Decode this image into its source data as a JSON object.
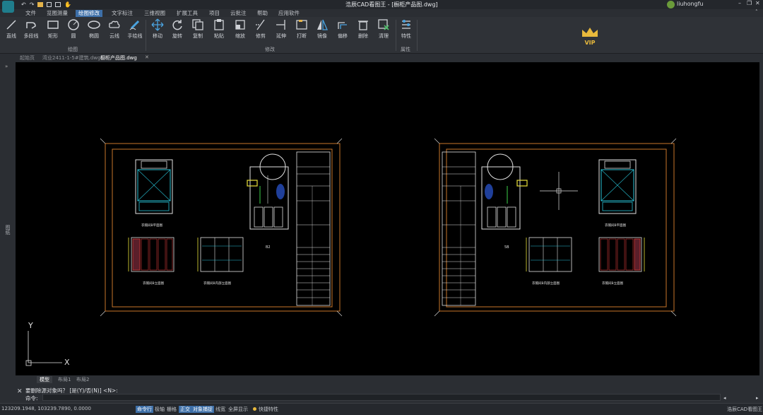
{
  "window": {
    "title": "浩辰CAD看图王 - [橱柜产品图.dwg]",
    "user": "liuhongfu"
  },
  "menu": [
    "文件",
    "览图测量",
    "绘图修改",
    "文字标注",
    "三维视图",
    "扩展工具",
    "项目",
    "云批注",
    "帮助",
    "应用软件"
  ],
  "menu_active": "绘图修改",
  "ribbon": {
    "draw_tools": [
      "直线",
      "多段线",
      "矩形",
      "圆",
      "椭圆",
      "云线",
      "手绘线"
    ],
    "draw_group": "绘图",
    "modify_tools": [
      "移动",
      "旋转",
      "复制",
      "粘贴",
      "缩放",
      "修剪",
      "延伸",
      "打断",
      "镜像",
      "偏移",
      "删除",
      "清理"
    ],
    "modify_group": "修改",
    "prop_tools": [
      "特性"
    ],
    "prop_group": "属性",
    "vip": "VIP"
  },
  "doc_tabs": [
    "起始页",
    "湾业2411-1-5#建筑.dwg",
    "橱柜产品图.dwg"
  ],
  "doc_tab_active": 2,
  "drawing": {
    "sheet_left": {
      "label_top": "衣帽间B平面图",
      "label_a": "衣帽间B立面图",
      "label_b": "衣帽间B内部立面图",
      "tag": "B2"
    },
    "sheet_right": {
      "label_top": "衣帽间B平面图",
      "label_a": "衣帽间B内部立面图",
      "label_b": "衣帽间B立面图",
      "tag": "5B"
    },
    "ucs": {
      "x": "X",
      "y": "Y"
    },
    "colors": {
      "frame": "#c8762a",
      "line": "#e0e0e0",
      "cyan": "#27c2d6",
      "red": "#d63a3a",
      "yellow": "#e8e03a"
    }
  },
  "side_label": "图纸",
  "layout_tabs": [
    "模型",
    "布局1",
    "布局2"
  ],
  "layout_active": 0,
  "command": {
    "history": "要删除源对象吗？ [是(Y)/否(N)] <N>:",
    "prompt": "命令:"
  },
  "status": {
    "coords": "123209.1948, 103239.7890, 0.0000",
    "items": [
      "命令行",
      "极轴",
      "栅格",
      "正交",
      "对象捕捉",
      "线宽",
      "全屏显示",
      "快捷特性"
    ],
    "on_items": [
      "命令行",
      "正交",
      "对象捕捉"
    ],
    "brand": "浩辰CAD看图王"
  }
}
